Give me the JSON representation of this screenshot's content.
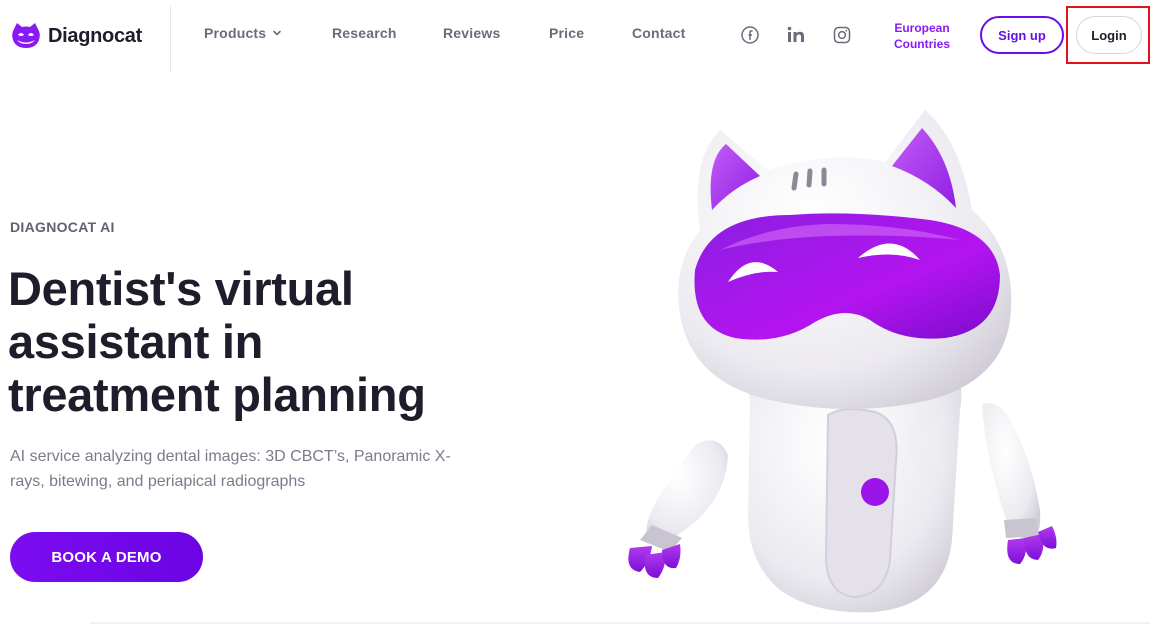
{
  "brand": {
    "name": "Diagnocat",
    "logo_icon": "cat-mask-logo-icon",
    "accent": "#8b19f5"
  },
  "nav": {
    "items": [
      {
        "key": "products",
        "label": "Products",
        "has_dropdown": true
      },
      {
        "key": "research",
        "label": "Research"
      },
      {
        "key": "reviews",
        "label": "Reviews"
      },
      {
        "key": "price",
        "label": "Price"
      },
      {
        "key": "contact",
        "label": "Contact"
      }
    ],
    "social": [
      "facebook-icon",
      "linkedin-icon",
      "instagram-icon"
    ],
    "region": {
      "line1": "European",
      "line2": "Countries"
    },
    "signup_label": "Sign up",
    "login_label": "Login"
  },
  "hero": {
    "eyebrow": "DIAGNOCAT AI",
    "headline_lines": [
      "Dentist's virtual",
      "assistant in",
      "treatment planning"
    ],
    "description_lines": [
      "AI service analyzing dental images: 3D CBCT’s, Panoramic X-",
      "rays, bitewing, and periapical radiographs"
    ],
    "cta_label": "BOOK A DEMO"
  },
  "colors": {
    "primary": "#6a0ee8",
    "highlight_box": "#e0121c",
    "text_dark": "#1d1d2b",
    "text_muted": "#7a7c8c"
  }
}
